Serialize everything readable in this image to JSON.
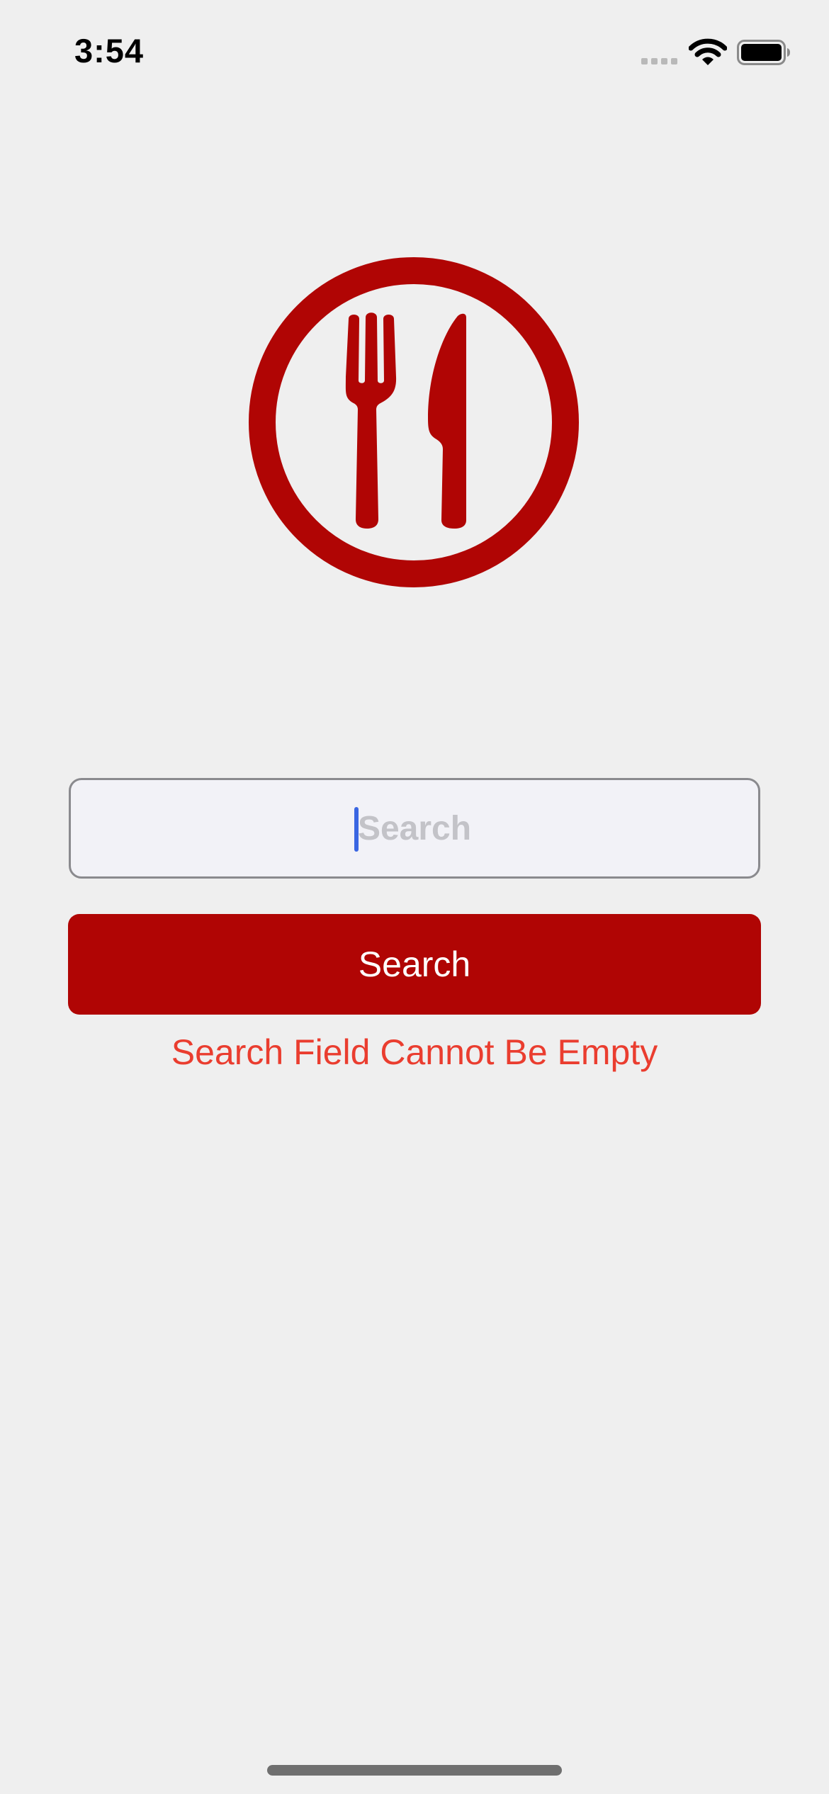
{
  "status_bar": {
    "time": "3:54",
    "icons": [
      "cellular-signal-icon",
      "wifi-icon",
      "battery-icon"
    ]
  },
  "logo": {
    "icon": "fork-and-knife-icon",
    "color": "#b00504"
  },
  "search": {
    "placeholder": "Search",
    "value": ""
  },
  "search_button": {
    "label": "Search",
    "color": "#b00504"
  },
  "error": {
    "message": "Search Field Cannot Be Empty",
    "color": "#ea3d2f"
  }
}
